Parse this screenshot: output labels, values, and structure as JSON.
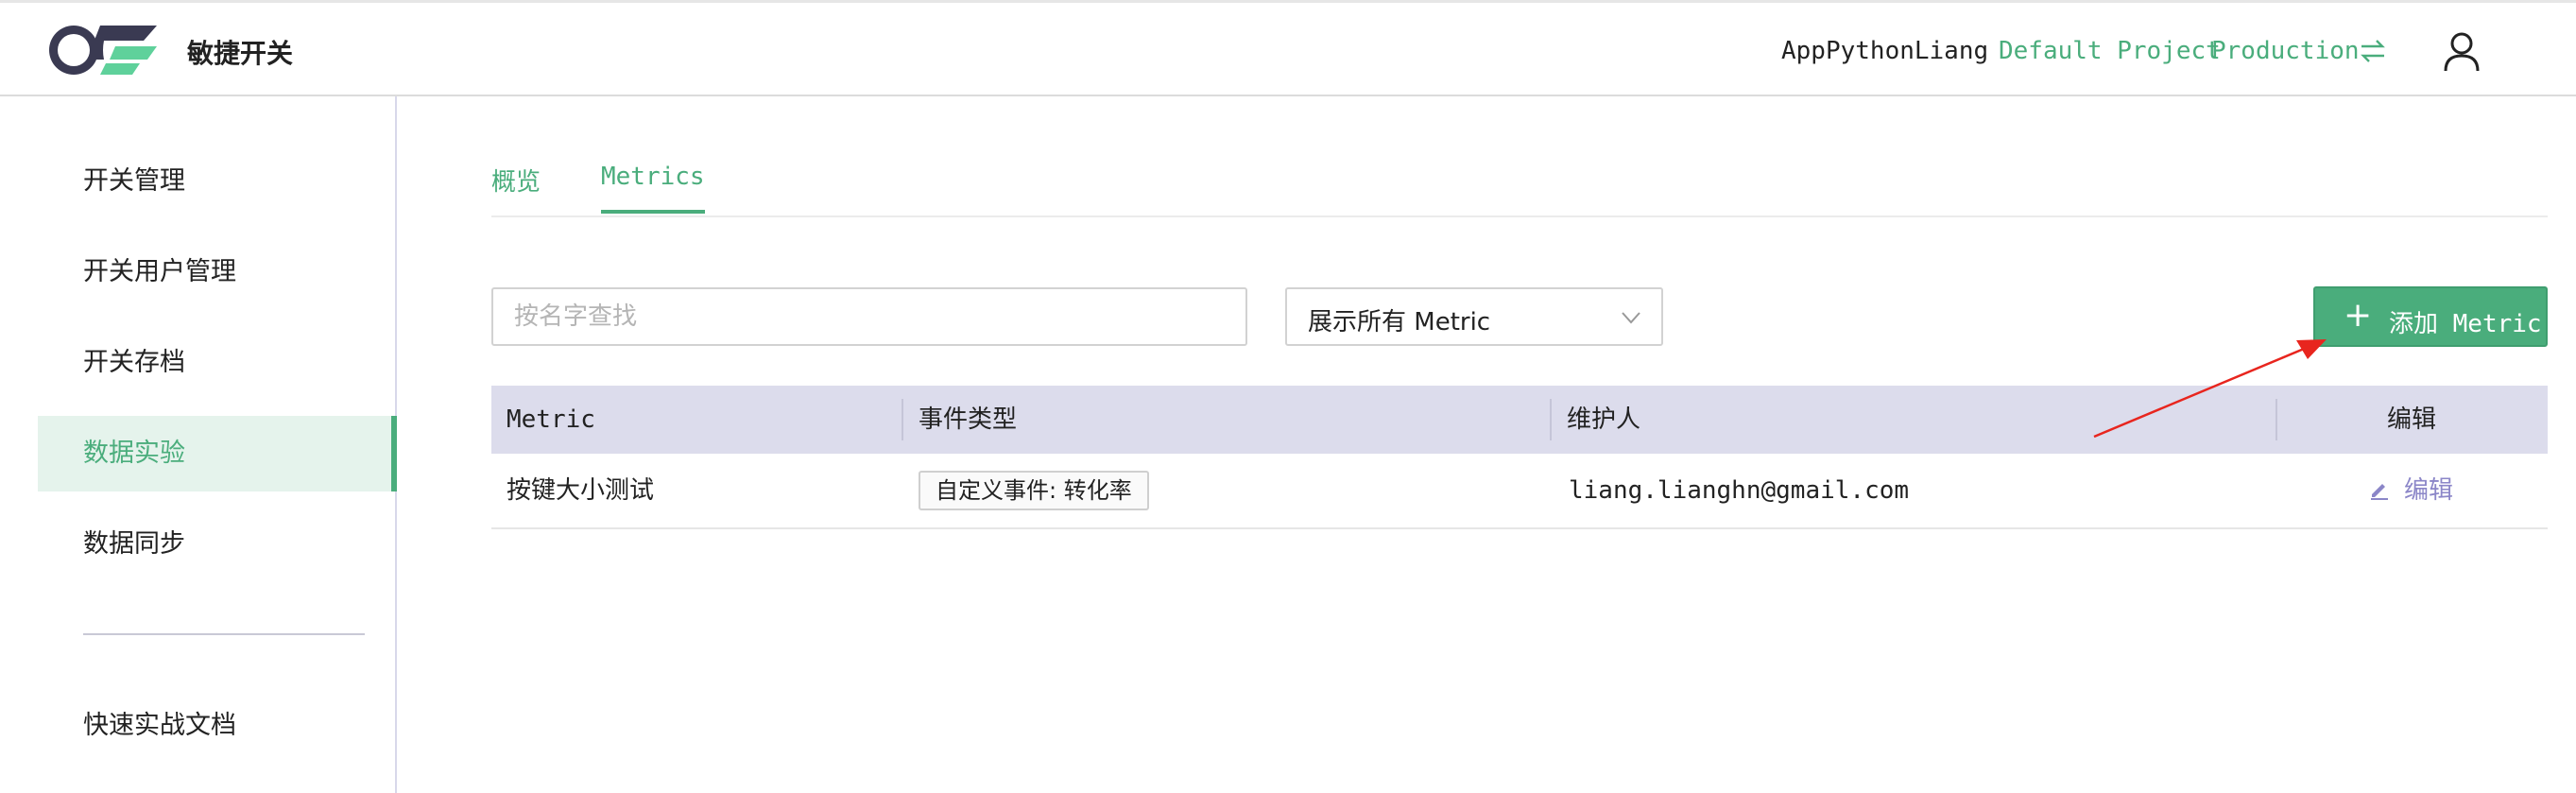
{
  "header": {
    "brand_name": "敏捷开关",
    "account": "AppPythonLiang",
    "project": "Default Project",
    "environment": "Production",
    "switch_icon": "swap-arrows-icon",
    "user_icon": "user-icon"
  },
  "sidebar": {
    "items": [
      {
        "label": "开关管理"
      },
      {
        "label": "开关用户管理"
      },
      {
        "label": "开关存档"
      },
      {
        "label": "数据实验",
        "active": true
      },
      {
        "label": "数据同步"
      },
      {
        "label": "快速实战文档"
      }
    ]
  },
  "tabs": [
    {
      "label": "概览"
    },
    {
      "label": "Metrics",
      "active": true
    }
  ],
  "filters": {
    "search_placeholder": "按名字查找",
    "select_value": "展示所有 Metric"
  },
  "add_button": {
    "plus": "+",
    "label": "添加 Metric"
  },
  "table": {
    "columns": [
      "Metric",
      "事件类型",
      "维护人",
      "编辑"
    ],
    "rows": [
      {
        "metric": "按键大小测试",
        "event_type": "自定义事件: 转化率",
        "maintainer": "liang.lianghn@gmail.com",
        "edit": "编辑"
      }
    ]
  },
  "colors": {
    "accent": "#4aad7c",
    "edit_link": "#8b86c8",
    "table_header": "#dcdcec",
    "annotation_arrow": "#e8251e"
  }
}
